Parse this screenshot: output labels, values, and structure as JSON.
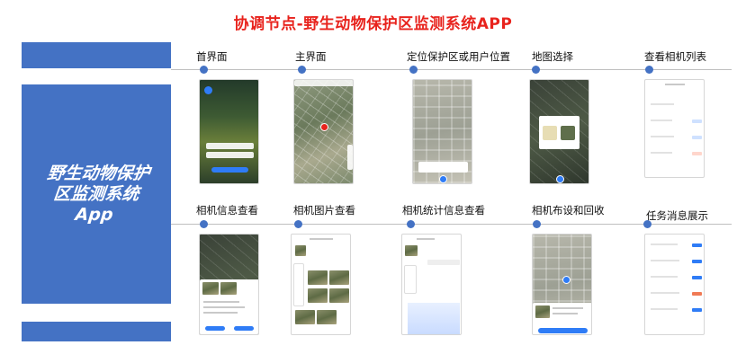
{
  "title": "协调节点-野生动物保护区监测系统APP",
  "panel_title": "野生动物保护区监测系统App",
  "panel_lines": [
    "野生动物保护",
    "区监测系统",
    "App"
  ],
  "colors": {
    "title": "#e8231d",
    "panel": "#4472c4",
    "dot": "#4472c4",
    "button": "#2f7cf6"
  },
  "row1": {
    "steps": [
      {
        "label": "首界面"
      },
      {
        "label": "主界面"
      },
      {
        "label": "定位保护区或用户位置"
      },
      {
        "label": "地图选择"
      },
      {
        "label": "查看相机列表"
      }
    ]
  },
  "row2": {
    "steps": [
      {
        "label": "相机信息查看"
      },
      {
        "label": "相机图片查看"
      },
      {
        "label": "相机统计信息查看"
      },
      {
        "label": "相机布设和回收"
      },
      {
        "label": "任务消息展示"
      }
    ]
  }
}
